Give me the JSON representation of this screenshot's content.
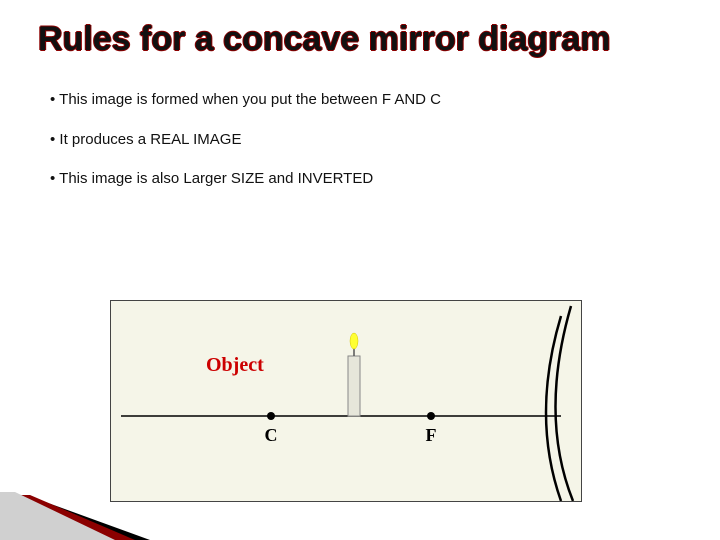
{
  "title": "Rules for a concave mirror diagram",
  "bullets": [
    "This image is formed when you put the between F  AND C",
    " It produces a REAL IMAGE",
    "This image is also Larger SIZE and INVERTED"
  ],
  "diagram": {
    "object_label": "Object",
    "c_label": "C",
    "f_label": "F",
    "colors": {
      "object_text": "#cc0000",
      "axis": "#000000",
      "candle_body": "#e0e0d0",
      "candle_outline": "#888888",
      "flame": "#ffff33",
      "mirror": "#000000",
      "point_fill": "#000000",
      "bg": "#f5f5e8"
    }
  }
}
